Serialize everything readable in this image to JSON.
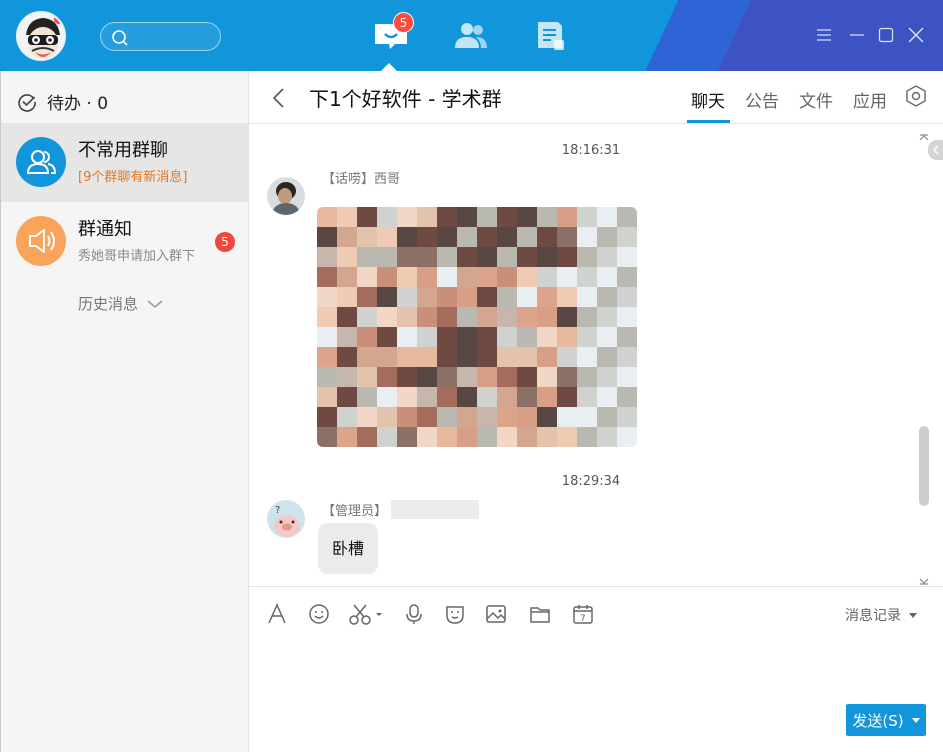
{
  "colors": {
    "brand": "#1296db",
    "badge": "#f0473c",
    "alert_text": "#e8761c",
    "sidebar_bg": "#f5f5f5"
  },
  "topbar": {
    "search_icon": "search-icon",
    "nav": [
      {
        "icon": "messages-icon",
        "badge": "5"
      },
      {
        "icon": "contacts-icon"
      },
      {
        "icon": "space-icon"
      }
    ],
    "window_controls": [
      "menu-icon",
      "minimize-icon",
      "maximize-icon",
      "close-icon"
    ]
  },
  "sidebar": {
    "todo_label": "待办 · 0",
    "conversations": [
      {
        "name": "不常用群聊",
        "subtitle": "[9个群聊有新消息]",
        "icon": "group-icon"
      },
      {
        "name": "群通知",
        "subtitle": "秀她哥申请加入群下",
        "badge": "5",
        "icon": "speaker-icon"
      }
    ],
    "history_label": "历史消息"
  },
  "chat": {
    "title": "下1个好软件 - 学术群",
    "tabs": [
      "聊天",
      "公告",
      "文件",
      "应用"
    ],
    "active_tab": "聊天",
    "messages": [
      {
        "time": "18:16:31",
        "sender": "【话唠】西哥",
        "type": "image"
      },
      {
        "time": "18:29:34",
        "sender": "【管理员】",
        "type": "text",
        "text": "卧槽"
      }
    ]
  },
  "composer": {
    "tools": [
      "font-icon",
      "emoji-icon",
      "scissors-icon",
      "microphone-icon",
      "mask-icon",
      "image-icon",
      "folder-icon",
      "calendar-icon"
    ],
    "history_label": "消息记录",
    "send_label": "发送(S)"
  }
}
